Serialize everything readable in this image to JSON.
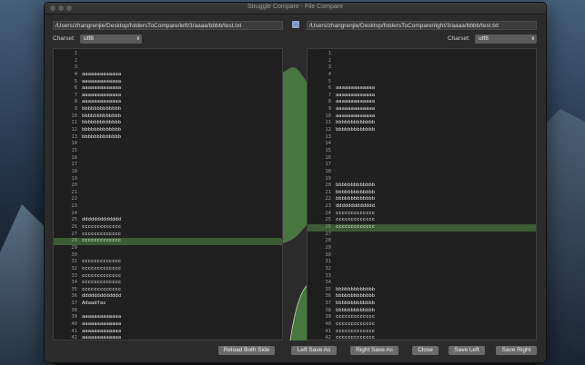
{
  "window": {
    "title": "Struggle Compare - File Compare"
  },
  "left": {
    "path": "/Users/zhangrenjie/Desktop/foldersToCompare/left/3/aaaa/bbbb/test.txt",
    "charset_label": "Charset:",
    "charset_value": "utf8"
  },
  "right": {
    "path": "/Users/zhangrenjie/Desktop/foldersToCompare/right/3/aaaa/bbbb/test.txt",
    "charset_label": "Charset:",
    "charset_value": "utf8"
  },
  "left_lines": [
    {
      "n": "1",
      "t": ""
    },
    {
      "n": "2",
      "t": ""
    },
    {
      "n": "3",
      "t": ""
    },
    {
      "n": "4",
      "t": "aaaaaaaaaaaaa"
    },
    {
      "n": "5",
      "t": "aaaaaaaaaaaaa"
    },
    {
      "n": "6",
      "t": "aaaaaaaaaaaaa"
    },
    {
      "n": "7",
      "t": "aaaaaaaaaaaaa"
    },
    {
      "n": "8",
      "t": "aaaaaaaaaaaaa"
    },
    {
      "n": "9",
      "t": "bbbbbbbbbbbbb"
    },
    {
      "n": "10",
      "t": "bbbbbbbbbbbbb"
    },
    {
      "n": "11",
      "t": "bbbbbbbbbbbbb"
    },
    {
      "n": "12",
      "t": "bbbbbbbbbbbbb"
    },
    {
      "n": "13",
      "t": "bbbbbbbbbbbbb"
    },
    {
      "n": "14",
      "t": ""
    },
    {
      "n": "15",
      "t": ""
    },
    {
      "n": "16",
      "t": ""
    },
    {
      "n": "17",
      "t": ""
    },
    {
      "n": "18",
      "t": ""
    },
    {
      "n": "19",
      "t": ""
    },
    {
      "n": "20",
      "t": ""
    },
    {
      "n": "21",
      "t": ""
    },
    {
      "n": "22",
      "t": ""
    },
    {
      "n": "23",
      "t": ""
    },
    {
      "n": "24",
      "t": ""
    },
    {
      "n": "25",
      "t": "ddddddddddddd"
    },
    {
      "n": "26",
      "t": "ccccccccccccc"
    },
    {
      "n": "27",
      "t": "ccccccccccccc"
    },
    {
      "n": "28",
      "t": "ccccccccccccc"
    },
    {
      "n": "29",
      "t": ""
    },
    {
      "n": "30",
      "t": ""
    },
    {
      "n": "31",
      "t": "ccccccccccccc"
    },
    {
      "n": "32",
      "t": "ccccccccccccc"
    },
    {
      "n": "33",
      "t": "ccccccccccccc"
    },
    {
      "n": "34",
      "t": "ccccccccccccc"
    },
    {
      "n": "35",
      "t": "ccccccccccccc"
    },
    {
      "n": "36",
      "t": "ddddddddddddd"
    },
    {
      "n": "37",
      "t": "Adaadfas"
    },
    {
      "n": "38",
      "t": ""
    },
    {
      "n": "39",
      "t": "aaaaaaaaaaaaa"
    },
    {
      "n": "40",
      "t": "aaaaaaaaaaaaa"
    },
    {
      "n": "41",
      "t": "aaaaaaaaaaaaa"
    },
    {
      "n": "42",
      "t": "aaaaaaaaaaaaa"
    }
  ],
  "right_lines": [
    {
      "n": "1",
      "t": ""
    },
    {
      "n": "2",
      "t": ""
    },
    {
      "n": "3",
      "t": ""
    },
    {
      "n": "4",
      "t": ""
    },
    {
      "n": "5",
      "t": ""
    },
    {
      "n": "6",
      "t": "aaaaaaaaaaaaa"
    },
    {
      "n": "7",
      "t": "aaaaaaaaaaaaa"
    },
    {
      "n": "8",
      "t": "aaaaaaaaaaaaa"
    },
    {
      "n": "9",
      "t": "aaaaaaaaaaaaa"
    },
    {
      "n": "10",
      "t": "aaaaaaaaaaaaa"
    },
    {
      "n": "11",
      "t": "bbbbbbbbbbbbb"
    },
    {
      "n": "12",
      "t": "bbbbbbbbbbbbb"
    },
    {
      "n": "13",
      "t": ""
    },
    {
      "n": "14",
      "t": ""
    },
    {
      "n": "15",
      "t": ""
    },
    {
      "n": "16",
      "t": ""
    },
    {
      "n": "17",
      "t": ""
    },
    {
      "n": "18",
      "t": ""
    },
    {
      "n": "19",
      "t": ""
    },
    {
      "n": "20",
      "t": "bbbbbbbbbbbbb"
    },
    {
      "n": "21",
      "t": "bbbbbbbbbbbbb"
    },
    {
      "n": "22",
      "t": "bbbbbbbbbbbbb"
    },
    {
      "n": "23",
      "t": "ddddddddddddd"
    },
    {
      "n": "24",
      "t": "ccccccccccccc"
    },
    {
      "n": "25",
      "t": "ccccccccccccc"
    },
    {
      "n": "26",
      "t": "ccccccccccccc"
    },
    {
      "n": "27",
      "t": ""
    },
    {
      "n": "28",
      "t": ""
    },
    {
      "n": "29",
      "t": ""
    },
    {
      "n": "30",
      "t": ""
    },
    {
      "n": "31",
      "t": ""
    },
    {
      "n": "32",
      "t": ""
    },
    {
      "n": "33",
      "t": ""
    },
    {
      "n": "34",
      "t": ""
    },
    {
      "n": "35",
      "t": "bbbbbbbbbbbbb"
    },
    {
      "n": "36",
      "t": "bbbbbbbbbbbbb"
    },
    {
      "n": "37",
      "t": "bbbbbbbbbbbbb"
    },
    {
      "n": "38",
      "t": "bbbbbbbbbbbbb"
    },
    {
      "n": "39",
      "t": "ccccccccccccc"
    },
    {
      "n": "40",
      "t": "ccccccccccccc"
    },
    {
      "n": "41",
      "t": "ccccccccccccc"
    },
    {
      "n": "42",
      "t": "ccccccccccccc"
    }
  ],
  "highlight": {
    "left_line": "28",
    "right_line": "26",
    "color": "#3c5a34"
  },
  "buttons": {
    "reload_both": "Reload Both Side",
    "left_save_as": "Left Save As",
    "right_save_as": "Right Save As",
    "close": "Close",
    "save_left": "Save Left",
    "save_right": "Save Right"
  }
}
